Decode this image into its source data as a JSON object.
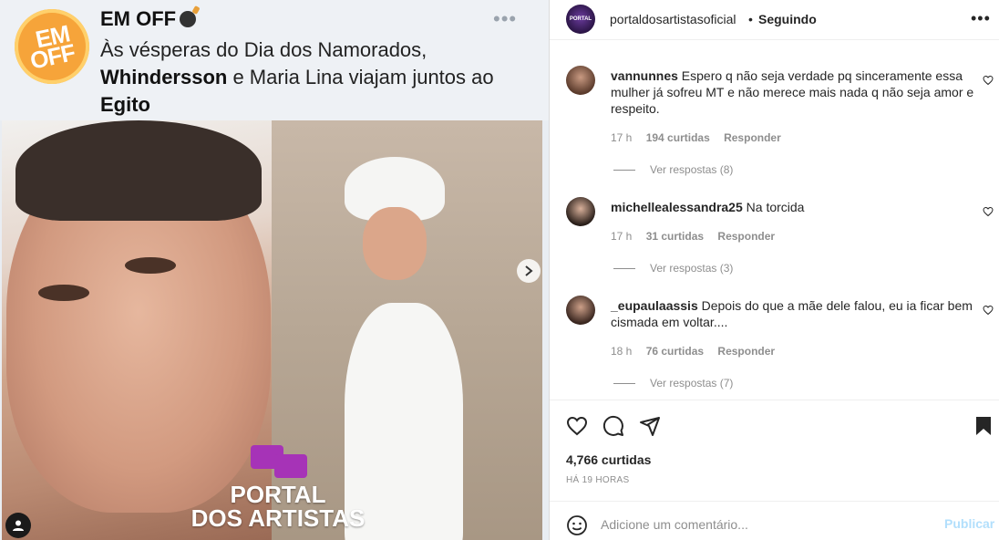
{
  "tweet": {
    "logo_text_1": "EM",
    "logo_text_2": "OFF",
    "name": "EM OFF",
    "line1": "Às vésperas do Dia dos Namorados,",
    "bold_name": "Whindersson",
    "line2_rest": " e Maria Lina viajam juntos ao",
    "line3": "Egito",
    "more": "•••"
  },
  "watermark": {
    "line1": "PORTAL",
    "line2": "DOS ARTISTAS"
  },
  "post": {
    "username": "portaldosartistasoficial",
    "separator": "•",
    "follow_status": "Seguindo",
    "avatar_text": "PORTAL",
    "more": "•••"
  },
  "comments": [
    {
      "username": "vannunnes",
      "text": " Espero q não seja verdade pq sinceramente essa mulher já sofreu MT e não merece mais nada q não seja amor e respeito.",
      "time": "17 h",
      "likes": "194 curtidas",
      "reply": "Responder",
      "view_replies": "Ver respostas (8)"
    },
    {
      "username": "michellealessandra25",
      "text": " Na torcida",
      "time": "17 h",
      "likes": "31 curtidas",
      "reply": "Responder",
      "view_replies": "Ver respostas (3)"
    },
    {
      "username": "_eupaulaassis",
      "text": " Depois do que a mãe dele falou, eu ia ficar bem cismada em voltar....",
      "time": "18 h",
      "likes": "76 curtidas",
      "reply": "Responder",
      "view_replies": "Ver respostas (7)"
    }
  ],
  "footer": {
    "likes": "4,766 curtidas",
    "time": "HÁ 19 HORAS",
    "comment_placeholder": "Adicione um comentário...",
    "publish": "Publicar"
  },
  "icons": {
    "heart": "heart-icon",
    "comment": "comment-icon",
    "share": "paper-plane-icon",
    "save": "bookmark-icon",
    "emoji": "smiley-icon"
  },
  "colors": {
    "publish_disabled": "#b2dffc",
    "meta_gray": "#8e8e8e",
    "watermark_purple": "#a633b7"
  }
}
